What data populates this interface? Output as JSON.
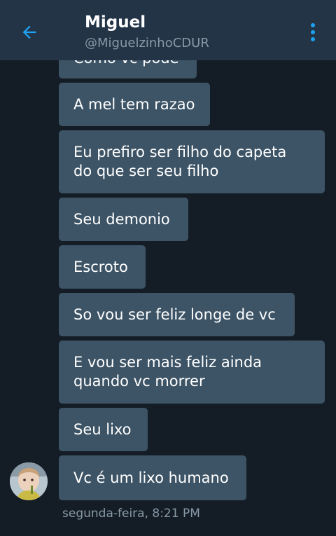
{
  "header": {
    "title": "Miguel",
    "handle": "@MiguelzinhoCDUR",
    "back_icon": "arrow-left-icon",
    "menu_icon": "more-vertical-icon",
    "accent_color": "#1da1f2"
  },
  "messages": [
    {
      "text": "Como vc pode"
    },
    {
      "text": "A mel tem razao"
    },
    {
      "text": "Eu prefiro ser filho do capeta\ndo que ser seu filho"
    },
    {
      "text": "Seu demonio"
    },
    {
      "text": "Escroto"
    },
    {
      "text": "So vou ser feliz longe de vc"
    },
    {
      "text": "E vou ser mais feliz ainda\nquando vc morrer"
    },
    {
      "text": "Seu lixo"
    },
    {
      "text": "Vc é um lixo humano"
    }
  ],
  "last_message_timestamp": "segunda-feira, 8:21 PM",
  "colors": {
    "background": "#141d26",
    "header": "#243447",
    "bubble": "#3d5466",
    "secondary_text": "#8899a6"
  }
}
